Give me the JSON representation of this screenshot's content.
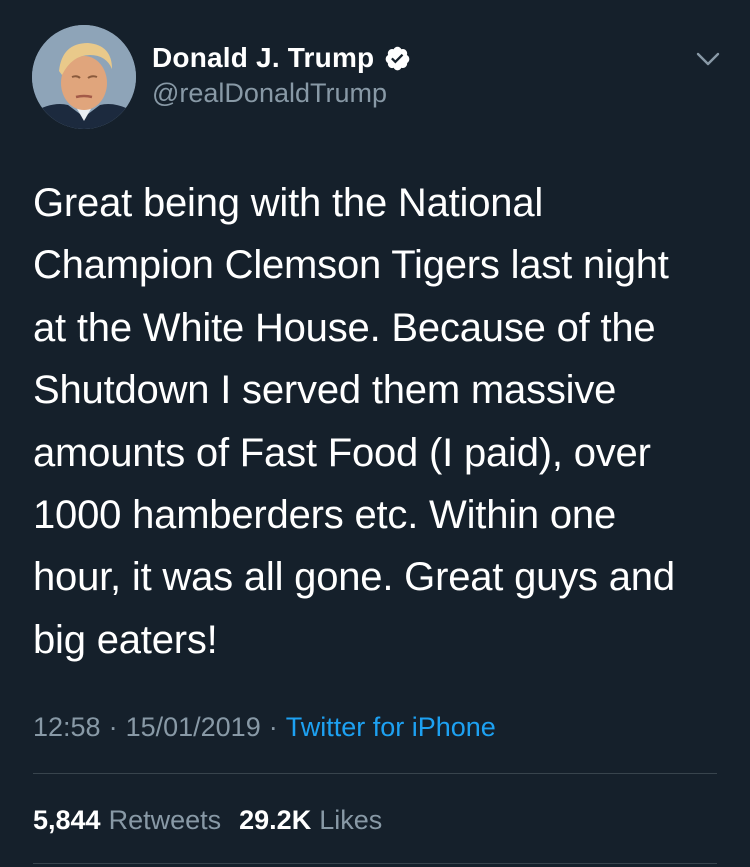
{
  "user": {
    "display_name": "Donald J. Trump",
    "handle": "@realDonaldTrump",
    "verified": true,
    "verified_color": "#ffffff"
  },
  "tweet": {
    "text": "Great being with the National\nChampion Clemson Tigers last night\nat the White House. Because of the\nShutdown I served them massive\namounts of Fast Food (I paid), over\n1000 hamberders etc. Within one\nhour, it was all gone. Great guys and\nbig eaters!",
    "time": "12:58",
    "date": "15/01/2019",
    "separator": "·",
    "source": "Twitter for iPhone"
  },
  "stats": {
    "retweets_count": "5,844",
    "retweets_label": "Retweets",
    "likes_count": "29.2K",
    "likes_label": "Likes"
  },
  "icons": {
    "verified": "verified-badge-icon",
    "menu": "chevron-down-icon"
  },
  "colors": {
    "background": "#15202b",
    "secondary_text": "#8899a6",
    "link": "#1da1f2",
    "divider": "#38444d"
  }
}
